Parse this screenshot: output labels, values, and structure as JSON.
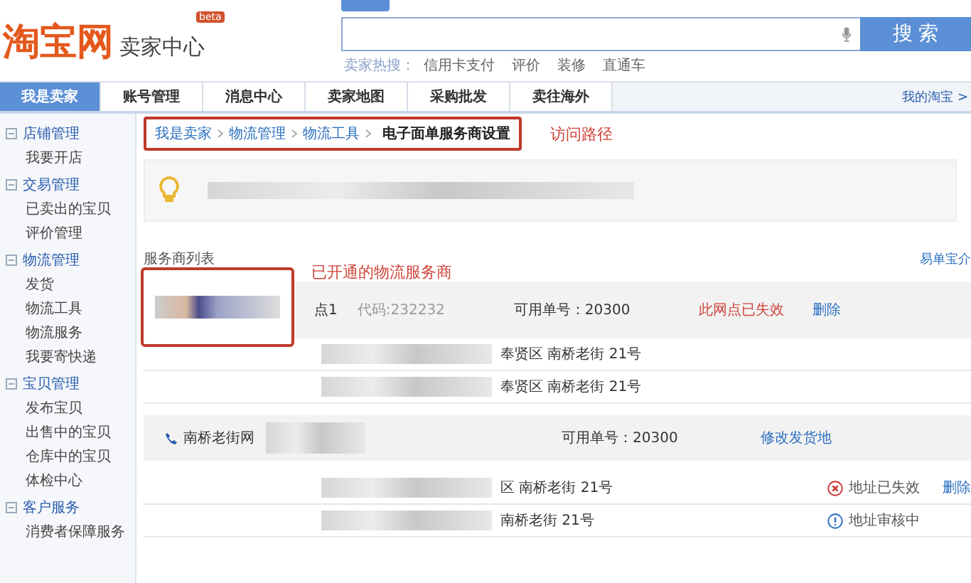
{
  "header": {
    "logo": "淘宝网",
    "subtitle": "卖家中心",
    "badge": "beta",
    "search_button": "搜 索",
    "hot_label": "卖家热搜：",
    "hot_links": [
      "信用卡支付",
      "评价",
      "装修",
      "直通车"
    ]
  },
  "nav": {
    "tabs": [
      {
        "label": "我是卖家",
        "selected": true
      },
      {
        "label": "账号管理",
        "selected": false
      },
      {
        "label": "消息中心",
        "selected": false
      },
      {
        "label": "卖家地图",
        "selected": false
      },
      {
        "label": "采购批发",
        "selected": false
      },
      {
        "label": "卖往海外",
        "selected": false
      }
    ],
    "right_link": "我的淘宝 >"
  },
  "sidebar": [
    {
      "title": "店铺管理",
      "items": [
        "我要开店"
      ]
    },
    {
      "title": "交易管理",
      "items": [
        "已卖出的宝贝",
        "评价管理"
      ]
    },
    {
      "title": "物流管理",
      "items": [
        "发货",
        "物流工具",
        "物流服务",
        "我要寄快递"
      ]
    },
    {
      "title": "宝贝管理",
      "items": [
        "发布宝贝",
        "出售中的宝贝",
        "仓库中的宝贝",
        "体检中心"
      ]
    },
    {
      "title": "客户服务",
      "items": [
        "消费者保障服务"
      ]
    }
  ],
  "breadcrumb": {
    "links": [
      "我是卖家",
      "物流管理",
      "物流工具"
    ],
    "current": "电子面单服务商设置"
  },
  "annotations": {
    "path": "访问路径",
    "provider": "已开通的物流服务商"
  },
  "list_title": "服务商列表",
  "intro_link": "易单宝介",
  "rows": [
    {
      "kind": "provider",
      "name": "点1",
      "code": "代码:232232",
      "available": "可用单号：20300",
      "status": "此网点已失效",
      "action": "删除"
    },
    {
      "kind": "address",
      "address": "奉贤区  南桥老街 21号"
    },
    {
      "kind": "address",
      "address": "奉贤区  南桥老街 21号"
    },
    {
      "kind": "branch",
      "name": "南桥老街网",
      "available": "可用单号：20300",
      "action": "修改发货地"
    },
    {
      "kind": "address",
      "address": "区  南桥老街 21号",
      "status": {
        "kind": "error",
        "text": "地址已失效"
      },
      "action": "删除"
    },
    {
      "kind": "address",
      "address": "南桥老街 21号",
      "status": {
        "kind": "info",
        "text": "地址审核中"
      }
    }
  ]
}
